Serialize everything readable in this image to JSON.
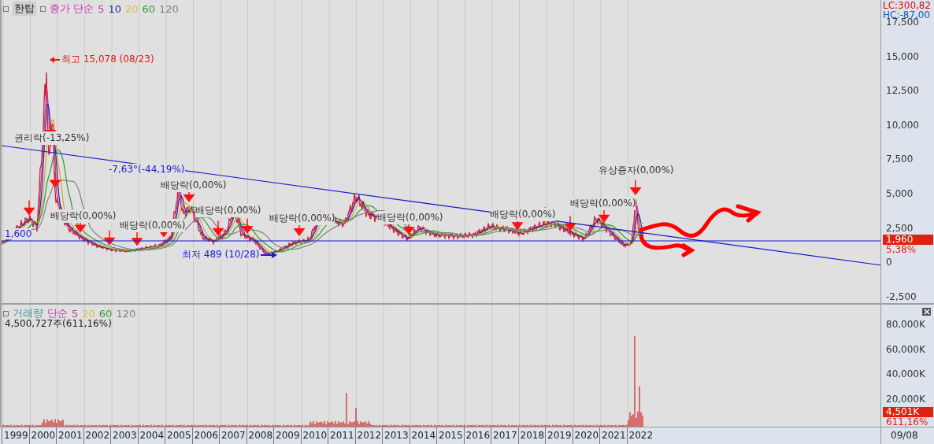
{
  "price_pane": {
    "legend": {
      "stock_name": "한탑",
      "indicator": "종가 단순",
      "periods": [
        {
          "label": "5",
          "color": "#cc33aa"
        },
        {
          "label": "10",
          "color": "#1a2f9a"
        },
        {
          "label": "20",
          "color": "#e0c040"
        },
        {
          "label": "60",
          "color": "#2a9a3a"
        },
        {
          "label": "120",
          "color": "#808080"
        }
      ]
    },
    "y_ticks": [
      "17,500",
      "15,000",
      "12,500",
      "10,000",
      "7,500",
      "5,000",
      "2,500",
      "0",
      "-2,500"
    ],
    "lc": "LC:300,82",
    "hc": "HC:-87,00",
    "current_price": "1,960",
    "change": "5,38%",
    "annotations": [
      {
        "kind": "high",
        "text": "최고 15,078 (08/23)"
      },
      {
        "kind": "label",
        "text": "권리락(-13,25%)"
      },
      {
        "kind": "trend",
        "text": "-7,63°(-44,19%)"
      },
      {
        "kind": "label",
        "text": "배당락(0,00%)"
      },
      {
        "kind": "label",
        "text": "유상증자(0,00%)"
      },
      {
        "kind": "trend",
        "text": "1,600"
      },
      {
        "kind": "low",
        "text": "최저 489 (10/28)"
      },
      {
        "kind": "label",
        "text": "배당락(0,00%)"
      },
      {
        "kind": "label",
        "text": "배당락(0,00%)"
      },
      {
        "kind": "label",
        "text": "배당락(0,00%)"
      },
      {
        "kind": "label",
        "text": "배당락(0,00%)"
      },
      {
        "kind": "label",
        "text": "배당락(0,00%)"
      },
      {
        "kind": "label",
        "text": "배당락(0,00%)"
      },
      {
        "kind": "label",
        "text": "배당락(0,00%)"
      }
    ]
  },
  "volume_pane": {
    "legend": {
      "title": "거래량",
      "indicator": "단순",
      "periods": [
        {
          "label": "5",
          "color": "#cc33aa"
        },
        {
          "label": "20",
          "color": "#e0c040"
        },
        {
          "label": "60",
          "color": "#2a9a3a"
        },
        {
          "label": "120",
          "color": "#808080"
        }
      ]
    },
    "total": "4,500,727주(611,16%)",
    "y_ticks": [
      "80,000K",
      "60,000K",
      "40,000K",
      "20,000K"
    ],
    "current": "4,501K",
    "change": "611,16%"
  },
  "x_axis": {
    "years": [
      "1999",
      "2000",
      "2001",
      "2002",
      "2003",
      "2004",
      "2005",
      "2006",
      "2007",
      "2008",
      "2009",
      "2010",
      "2011",
      "2012",
      "2013",
      "2014",
      "2015",
      "2016",
      "2017",
      "2018",
      "2019",
      "2020",
      "2021",
      "2022"
    ],
    "last_date": "09/08"
  }
}
